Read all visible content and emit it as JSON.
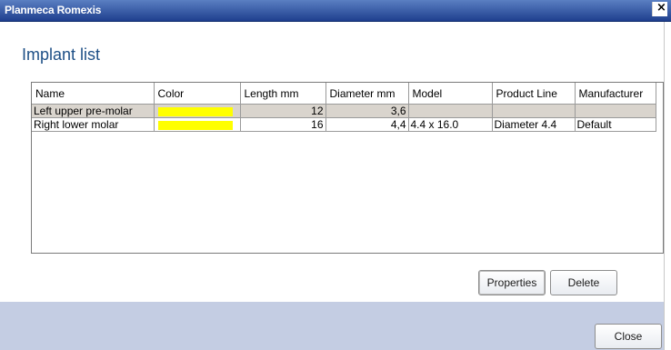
{
  "window": {
    "title": "Planmeca Romexis",
    "close_glyph": "×"
  },
  "heading": "Implant list",
  "table": {
    "columns": [
      "Name",
      "Color",
      "Length mm",
      "Diameter mm",
      "Model",
      "Product Line",
      "Manufacturer"
    ],
    "rows": [
      {
        "name": "Left upper pre-molar",
        "color": "#ffff00",
        "length": "12",
        "diameter": "3,6",
        "model": "",
        "product_line": "",
        "manufacturer": "",
        "selected": true
      },
      {
        "name": "Right lower molar",
        "color": "#ffff00",
        "length": "16",
        "diameter": "4,4",
        "model": "4.4 x 16.0",
        "product_line": "Diameter 4.4",
        "manufacturer": "Default",
        "selected": false
      }
    ]
  },
  "buttons": {
    "properties": "Properties",
    "delete": "Delete",
    "close": "Close"
  },
  "colors": {
    "titlebar": "#1f3f8e",
    "heading": "#1d4f86",
    "footer": "#c4cde3",
    "selected_row": "#d9d4cd"
  }
}
